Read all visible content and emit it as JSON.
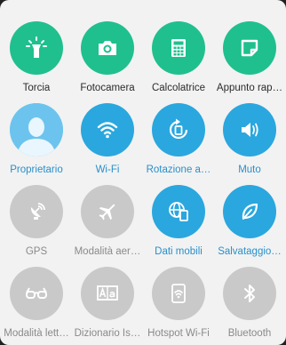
{
  "rows": [
    {
      "tiles": [
        {
          "label": "Torcia",
          "icon": "flashlight-icon"
        },
        {
          "label": "Fotocamera",
          "icon": "camera-icon"
        },
        {
          "label": "Calcolatrice",
          "icon": "calculator-icon"
        },
        {
          "label": "Appunto rap…",
          "icon": "quick-memo-icon"
        }
      ]
    },
    {
      "tiles": [
        {
          "label": "Proprietario",
          "icon": "user-avatar-icon"
        },
        {
          "label": "Wi-Fi",
          "icon": "wifi-icon"
        },
        {
          "label": "Rotazione a…",
          "icon": "auto-rotate-icon"
        },
        {
          "label": "Muto",
          "icon": "mute-speaker-icon"
        }
      ]
    },
    {
      "tiles": [
        {
          "label": "GPS",
          "icon": "gps-icon"
        },
        {
          "label": "Modalità aer…",
          "icon": "airplane-icon"
        },
        {
          "label": "Dati mobili",
          "icon": "mobile-data-icon"
        },
        {
          "label": "Salvataggio…",
          "icon": "leaf-power-saving-icon"
        }
      ]
    },
    {
      "tiles": [
        {
          "label": "Modalità lett…",
          "icon": "reading-glasses-icon"
        },
        {
          "label": "Dizionario Is…",
          "icon": "dictionary-icon"
        },
        {
          "label": "Hotspot Wi-Fi",
          "icon": "hotspot-icon"
        },
        {
          "label": "Bluetooth",
          "icon": "bluetooth-icon"
        }
      ]
    }
  ],
  "colors": {
    "green": "#1fc08e",
    "blue": "#2aa7de",
    "disabled": "#c9c9c9",
    "panel": "#f2f2f2"
  }
}
